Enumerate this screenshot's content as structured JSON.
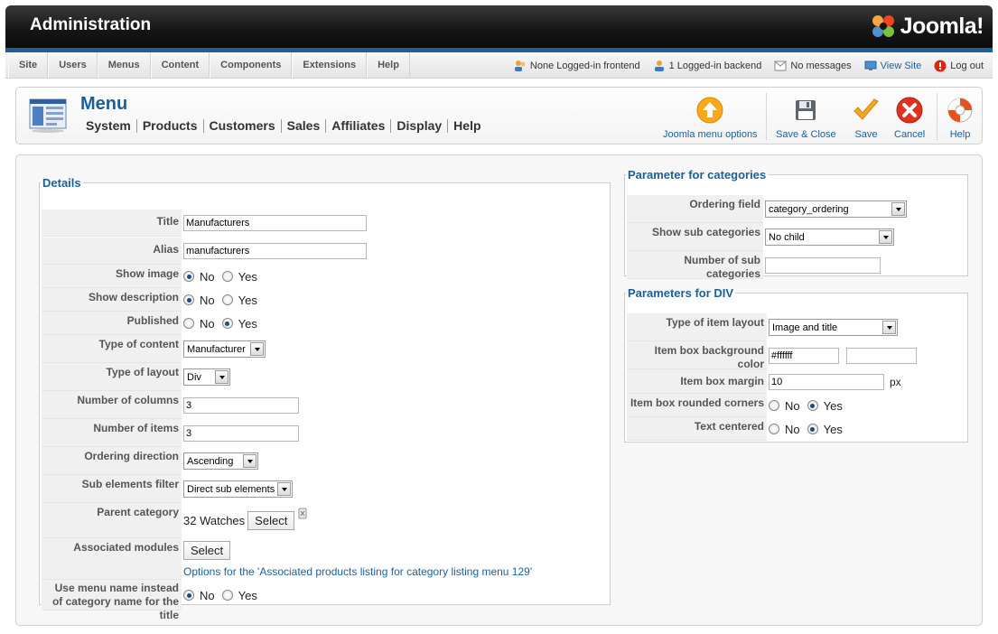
{
  "header": {
    "title": "Administration",
    "logo_text": "Joomla!"
  },
  "menubar": {
    "items": [
      "Site",
      "Users",
      "Menus",
      "Content",
      "Components",
      "Extensions",
      "Help"
    ],
    "status": {
      "frontend": "None Logged-in frontend",
      "backend": "1 Logged-in backend",
      "messages": "No messages",
      "view_site": "View Site",
      "logout": "Log out"
    }
  },
  "toolbar": {
    "page_title": "Menu",
    "subnav": [
      "System",
      "Products",
      "Customers",
      "Sales",
      "Affiliates",
      "Display",
      "Help"
    ],
    "buttons": {
      "menu_options": "Joomla menu options",
      "save_close": "Save & Close",
      "save": "Save",
      "cancel": "Cancel",
      "help": "Help"
    }
  },
  "details": {
    "legend": "Details",
    "title_label": "Title",
    "title_value": "Manufacturers",
    "alias_label": "Alias",
    "alias_value": "manufacturers",
    "show_image_label": "Show image",
    "show_description_label": "Show description",
    "published_label": "Published",
    "no": "No",
    "yes": "Yes",
    "type_content_label": "Type of content",
    "type_content_value": "Manufacturer",
    "type_layout_label": "Type of layout",
    "type_layout_value": "Div",
    "num_columns_label": "Number of columns",
    "num_columns_value": "3",
    "num_items_label": "Number of items",
    "num_items_value": "3",
    "ordering_dir_label": "Ordering direction",
    "ordering_dir_value": "Ascending",
    "sub_filter_label": "Sub elements filter",
    "sub_filter_value": "Direct sub elements",
    "parent_cat_label": "Parent category",
    "parent_cat_value": "32 Watches",
    "select": "Select",
    "assoc_modules_label": "Associated modules",
    "assoc_note": "Options for the 'Associated products listing for category listing menu 129'",
    "use_menu_name_label": "Use menu name instead of category name for the title"
  },
  "categories": {
    "legend": "Parameter for categories",
    "ordering_field_label": "Ordering field",
    "ordering_field_value": "category_ordering",
    "show_sub_label": "Show sub categories",
    "show_sub_value": "No child",
    "num_sub_label": "Number of sub categories",
    "num_sub_value": ""
  },
  "div_params": {
    "legend": "Parameters for DIV",
    "layout_label": "Type of item layout",
    "layout_value": "Image and title",
    "bg_color_label": "Item box background color",
    "bg_color_value": "#ffffff",
    "bg_color_value2": "",
    "margin_label": "Item box margin",
    "margin_value": "10",
    "margin_unit": "px",
    "rounded_label": "Item box rounded corners",
    "centered_label": "Text centered",
    "no": "No",
    "yes": "Yes"
  },
  "colors": {
    "accent": "#1c5f99",
    "header_bg": "#151515"
  }
}
